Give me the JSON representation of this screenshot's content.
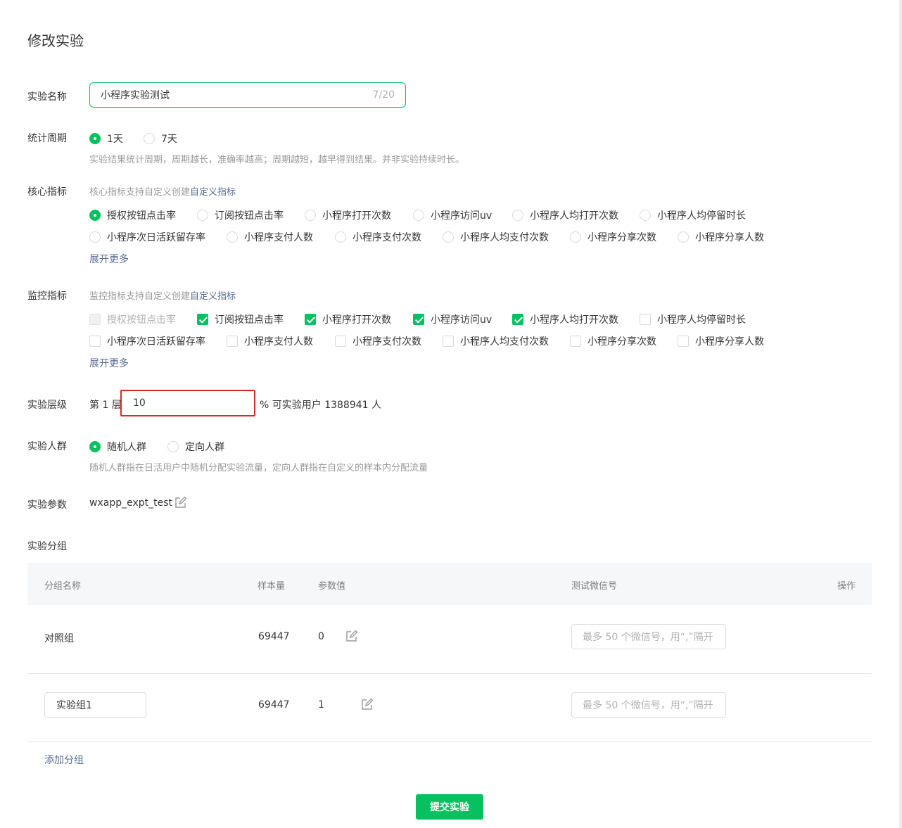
{
  "page_title": "修改实验",
  "name_field": {
    "label": "实验名称",
    "value": "小程序实验测试",
    "counter": "7/20"
  },
  "period": {
    "label": "统计周期",
    "options": [
      {
        "label": "1天",
        "checked": true
      },
      {
        "label": "7天",
        "checked": false
      }
    ],
    "hint": "实验结果统计周期，周期越长，准确率越高；周期越短，越早得到结果。并非实验持续时长。"
  },
  "core_metrics": {
    "label": "核心指标",
    "hint_prefix": "核心指标支持自定义创建",
    "hint_link": "自定义指标",
    "options": [
      {
        "label": "授权按钮点击率",
        "checked": true
      },
      {
        "label": "订阅按钮点击率",
        "checked": false
      },
      {
        "label": "小程序打开次数",
        "checked": false
      },
      {
        "label": "小程序访问uv",
        "checked": false
      },
      {
        "label": "小程序人均打开次数",
        "checked": false
      },
      {
        "label": "小程序人均停留时长",
        "checked": false
      },
      {
        "label": "小程序次日活跃留存率",
        "checked": false
      },
      {
        "label": "小程序支付人数",
        "checked": false
      },
      {
        "label": "小程序支付次数",
        "checked": false
      },
      {
        "label": "小程序人均支付次数",
        "checked": false
      },
      {
        "label": "小程序分享次数",
        "checked": false
      },
      {
        "label": "小程序分享人数",
        "checked": false
      }
    ],
    "expand": "展开更多"
  },
  "monitor_metrics": {
    "label": "监控指标",
    "hint_prefix": "监控指标支持自定义创建",
    "hint_link": "自定义指标",
    "options": [
      {
        "label": "授权按钮点击率",
        "checked": false,
        "disabled": true
      },
      {
        "label": "订阅按钮点击率",
        "checked": true
      },
      {
        "label": "小程序打开次数",
        "checked": true
      },
      {
        "label": "小程序访问uv",
        "checked": true
      },
      {
        "label": "小程序人均打开次数",
        "checked": true
      },
      {
        "label": "小程序人均停留时长",
        "checked": false
      },
      {
        "label": "小程序次日活跃留存率",
        "checked": false
      },
      {
        "label": "小程序支付人数",
        "checked": false
      },
      {
        "label": "小程序支付次数",
        "checked": false
      },
      {
        "label": "小程序人均支付次数",
        "checked": false
      },
      {
        "label": "小程序分享次数",
        "checked": false
      },
      {
        "label": "小程序分享人数",
        "checked": false
      }
    ],
    "expand": "展开更多"
  },
  "level": {
    "label": "实验层级",
    "prefix": "第 1 层",
    "value": "10",
    "suffix": "% 可实验用户 1388941 人"
  },
  "crowd": {
    "label": "实验人群",
    "options": [
      {
        "label": "随机人群",
        "checked": true
      },
      {
        "label": "定向人群",
        "checked": false
      }
    ],
    "hint": "随机人群指在日活用户中随机分配实验流量，定向人群指在自定义的样本内分配流量"
  },
  "param": {
    "label": "实验参数",
    "value": "wxapp_expt_test"
  },
  "groups": {
    "label": "实验分组",
    "columns": [
      "分组名称",
      "样本量",
      "参数值",
      "测试微信号",
      "操作"
    ],
    "rows": [
      {
        "name": "对照组",
        "samples": "69447",
        "param": "0",
        "wx_placeholder": "最多 50 个微信号，用“,”隔开"
      },
      {
        "name": "实验组1",
        "samples": "69447",
        "param": "1",
        "wx_placeholder": "最多 50 个微信号，用“,”隔开"
      }
    ],
    "add": "添加分组"
  },
  "submit": "提交实验",
  "colors": {
    "accent": "#07c160",
    "link": "#576b95",
    "highlight": "#e0262b"
  }
}
